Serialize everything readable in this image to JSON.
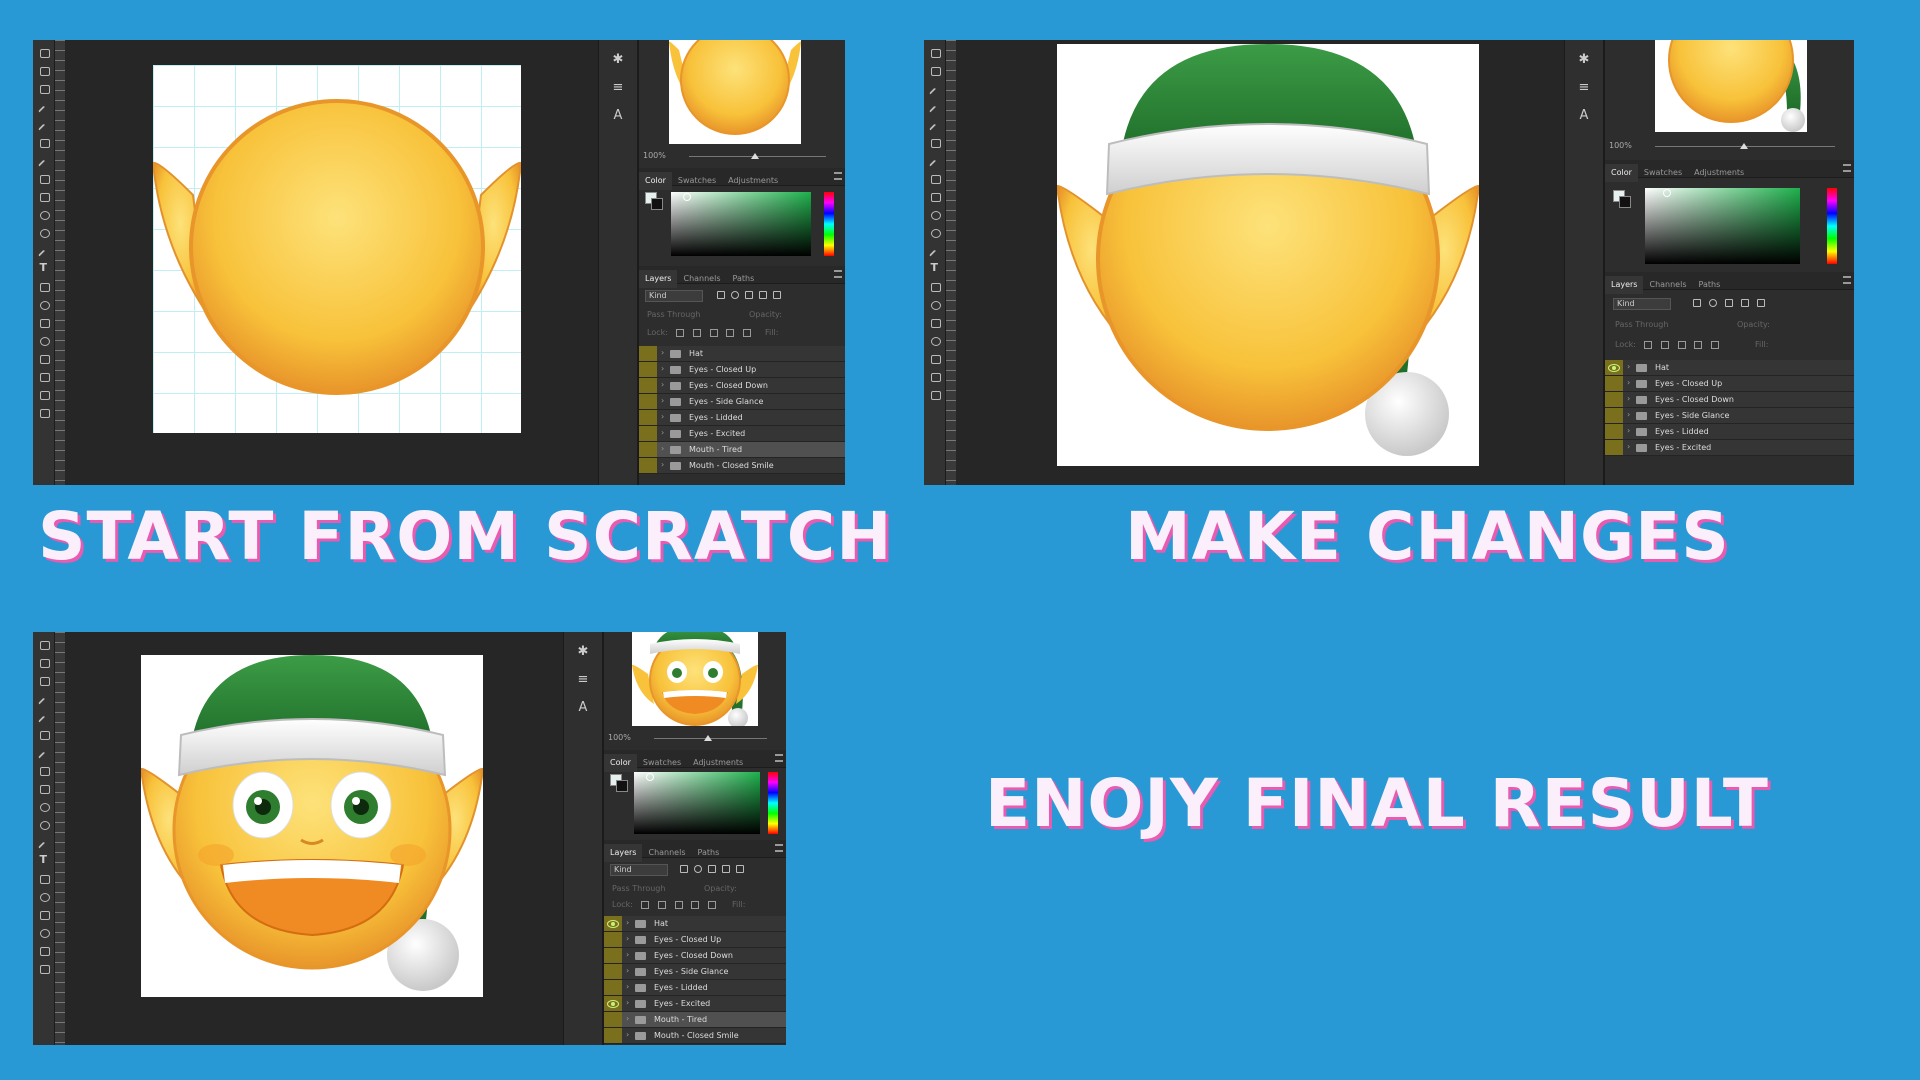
{
  "colors": {
    "background": "#2899d4",
    "caption_text": "#fbeffc",
    "caption_shadow": "#e75bb1",
    "face": "#f8c23a",
    "hat": "#2e8b3a",
    "layer_visible_strip": "#7a6f1c"
  },
  "captions": {
    "top_left": "START FROM SCRATCH",
    "top_right": "MAKE CHANGES",
    "bottom_right": "ENOJY FINAL RESULT"
  },
  "panels": [
    {
      "stage": "scratch",
      "zoom": "100%",
      "tabs": [
        "Color",
        "Swatches",
        "Adjustments"
      ],
      "layer_tabs": [
        "Layers",
        "Channels",
        "Paths"
      ],
      "kind_filter": "Kind",
      "blend_mode": "Pass Through",
      "opacity_label": "Opacity:",
      "lock_label": "Lock:",
      "fill_label": "Fill:",
      "layers": [
        {
          "name": "Hat",
          "visible": false
        },
        {
          "name": "Eyes - Closed Up",
          "visible": false
        },
        {
          "name": "Eyes - Closed Down",
          "visible": false
        },
        {
          "name": "Eyes - Side Glance",
          "visible": false
        },
        {
          "name": "Eyes - Lidded",
          "visible": false
        },
        {
          "name": "Eyes - Excited",
          "visible": false
        },
        {
          "name": "Mouth - Tired",
          "visible": false,
          "selected": true
        },
        {
          "name": "Mouth - Closed Smile",
          "visible": false
        }
      ]
    },
    {
      "stage": "changes",
      "zoom": "100%",
      "tabs": [
        "Color",
        "Swatches",
        "Adjustments"
      ],
      "layer_tabs": [
        "Layers",
        "Channels",
        "Paths"
      ],
      "kind_filter": "Kind",
      "blend_mode": "Pass Through",
      "opacity_label": "Opacity:",
      "lock_label": "Lock:",
      "fill_label": "Fill:",
      "layers": [
        {
          "name": "Hat",
          "visible": true
        },
        {
          "name": "Eyes - Closed Up",
          "visible": false
        },
        {
          "name": "Eyes - Closed Down",
          "visible": false
        },
        {
          "name": "Eyes - Side Glance",
          "visible": false
        },
        {
          "name": "Eyes - Lidded",
          "visible": false
        },
        {
          "name": "Eyes - Excited",
          "visible": false
        }
      ]
    },
    {
      "stage": "final",
      "zoom": "100%",
      "tabs": [
        "Color",
        "Swatches",
        "Adjustments"
      ],
      "layer_tabs": [
        "Layers",
        "Channels",
        "Paths"
      ],
      "kind_filter": "Kind",
      "blend_mode": "Pass Through",
      "opacity_label": "Opacity:",
      "lock_label": "Lock:",
      "fill_label": "Fill:",
      "layers": [
        {
          "name": "Hat",
          "visible": true
        },
        {
          "name": "Eyes - Closed Up",
          "visible": false
        },
        {
          "name": "Eyes - Closed Down",
          "visible": false
        },
        {
          "name": "Eyes - Side Glance",
          "visible": false
        },
        {
          "name": "Eyes - Lidded",
          "visible": false
        },
        {
          "name": "Eyes - Excited",
          "visible": true
        },
        {
          "name": "Mouth - Tired",
          "visible": false,
          "selected": true
        },
        {
          "name": "Mouth - Closed Smile",
          "visible": false
        }
      ]
    }
  ]
}
